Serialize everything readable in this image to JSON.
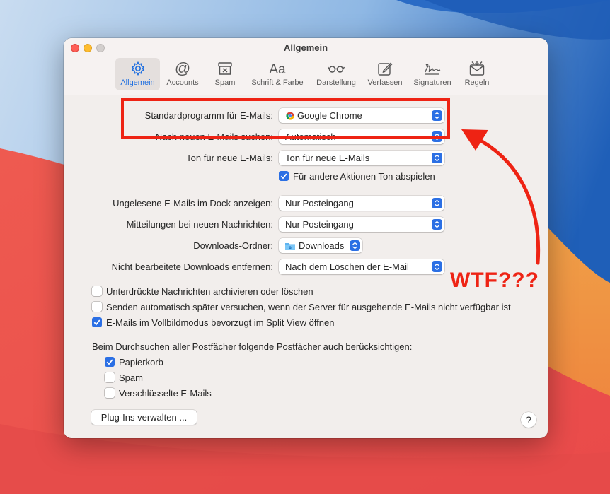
{
  "window": {
    "title": "Allgemein"
  },
  "toolbar": {
    "tabs": [
      {
        "label": "Allgemein",
        "icon": "gear-icon"
      },
      {
        "label": "Accounts",
        "icon": "at-icon"
      },
      {
        "label": "Spam",
        "icon": "junk-icon"
      },
      {
        "label": "Schrift & Farbe",
        "icon": "font-icon"
      },
      {
        "label": "Darstellung",
        "icon": "glasses-icon"
      },
      {
        "label": "Verfassen",
        "icon": "compose-icon"
      },
      {
        "label": "Signaturen",
        "icon": "signature-icon"
      },
      {
        "label": "Regeln",
        "icon": "rules-icon"
      }
    ],
    "active": "Allgemein"
  },
  "general": {
    "default_mail_label": "Standardprogramm für E-Mails:",
    "default_mail_value": "Google Chrome",
    "check_mail_label": "Nach neuen E-Mails suchen:",
    "check_mail_value": "Automatisch",
    "sound_label": "Ton für neue E-Mails:",
    "sound_value": "Ton für neue E-Mails",
    "sound_other_label": "Für andere Aktionen Ton abspielen",
    "sound_other_checked": true,
    "dock_label": "Ungelesene E-Mails im Dock anzeigen:",
    "dock_value": "Nur Posteingang",
    "notify_label": "Mitteilungen bei neuen Nachrichten:",
    "notify_value": "Nur Posteingang",
    "downloads_label": "Downloads-Ordner:",
    "downloads_value": "Downloads",
    "remove_label": "Nicht bearbeitete Downloads entfernen:",
    "remove_value": "Nach dem Löschen der E-Mail"
  },
  "options": [
    {
      "label": "Unterdrückte Nachrichten archivieren oder löschen",
      "checked": false
    },
    {
      "label": "Senden automatisch später versuchen, wenn der Server für ausgehende E-Mails nicht verfügbar ist",
      "checked": false
    },
    {
      "label": "E-Mails im Vollbildmodus bevorzugt im Split View öffnen",
      "checked": true
    }
  ],
  "search": {
    "heading": "Beim Durchsuchen aller Postfächer folgende Postfächer auch berücksichtigen:",
    "items": [
      {
        "label": "Papierkorb",
        "checked": true
      },
      {
        "label": "Spam",
        "checked": false
      },
      {
        "label": "Verschlüsselte E-Mails",
        "checked": false
      }
    ]
  },
  "footer": {
    "plugins_label": "Plug-Ins verwalten ...",
    "help_label": "?"
  },
  "annotation": {
    "text": "WTF???",
    "color": "#ee2314"
  },
  "colors": {
    "accent": "#2b6fe4",
    "annotation_red": "#ee2314"
  }
}
